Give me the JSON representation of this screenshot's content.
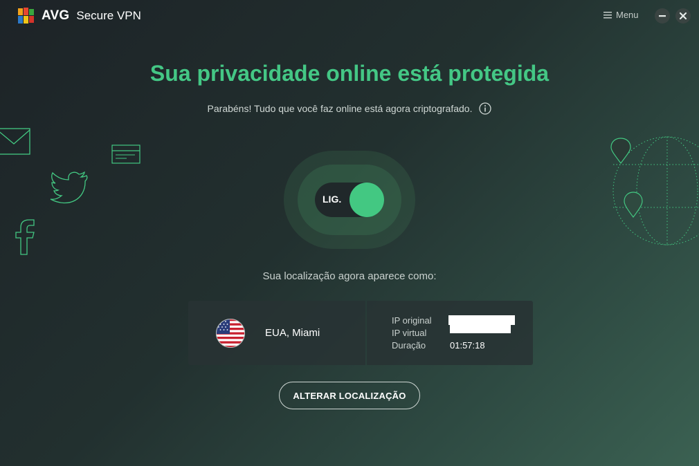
{
  "app": {
    "brand": "AVG",
    "product": "Secure VPN",
    "menu_label": "Menu"
  },
  "status": {
    "headline": "Sua privacidade online está protegida",
    "subline": "Parabéns! Tudo que você faz online está agora criptografado."
  },
  "toggle": {
    "label": "LIG.",
    "state": "on",
    "color": "#43c882"
  },
  "location": {
    "caption": "Sua localização agora aparece como:",
    "name": "EUA, Miami",
    "flag_icon": "us-flag-icon"
  },
  "connection": {
    "labels": [
      "IP original",
      "IP virtual",
      "Duração"
    ],
    "original_ip": "",
    "virtual_ip": "",
    "duration": "01:57:18"
  },
  "actions": {
    "change_location": "ALTERAR LOCALIZAÇÃO"
  },
  "colors": {
    "accent": "#44c785"
  }
}
